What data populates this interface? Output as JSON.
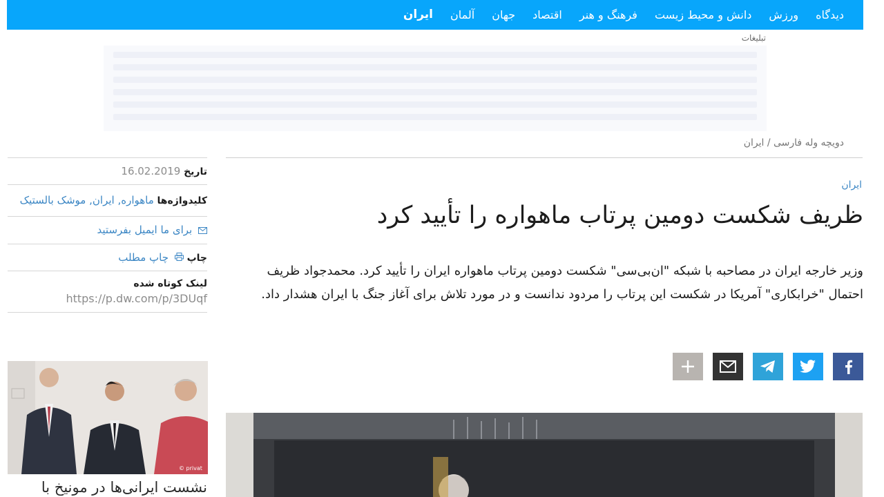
{
  "nav": {
    "items": [
      "ایران",
      "آلمان",
      "جهان",
      "اقتصاد",
      "فرهنگ و هنر",
      "دانش و محیط زیست",
      "ورزش",
      "دیدگاه"
    ]
  },
  "ad": {
    "label": "تبلیغات"
  },
  "breadcrumb": {
    "text": "دویچه وله فارسی / ایران"
  },
  "sidebar": {
    "date_label": "تاریخ",
    "date_value": "16.02.2019",
    "keywords_label": "کلیدواژه‌ها",
    "keywords": "ماهواره, ایران, موشک بالستیک",
    "email_link": "برای ما ایمیل بفرستید",
    "print_label": "چاپ",
    "print_link": "چاپ مطلب",
    "shortlink_label": "لینک کوتاه شده",
    "shortlink_url": "https://p.dw.com/p/3DUqf",
    "photo_credit": "© privat",
    "related_caption": "نشست ایرانی‌ها در مونیخ با"
  },
  "article": {
    "section": "ایران",
    "headline": "ظریف شکست دومین پرتاب ماهواره را تأیید کرد",
    "lead": "وزیر خارجه ایران در مصاحبه با شبکه \"ان‌بی‌سی\" شکست دومین پرتاب ماهواره ایران را تأیید کرد. محمدجواد ظریف احتمال \"خرابکاری\" آمریکا در شکست این پرتاب را مردود ندانست و در مورد تلاش برای آغاز جنگ با ایران هشدار داد."
  },
  "share": {
    "facebook_color": "#3b5998",
    "twitter_color": "#1da1f2",
    "telegram_color": "#2fa3d9",
    "email_color": "#333333",
    "more_color": "#b8b4b0"
  }
}
